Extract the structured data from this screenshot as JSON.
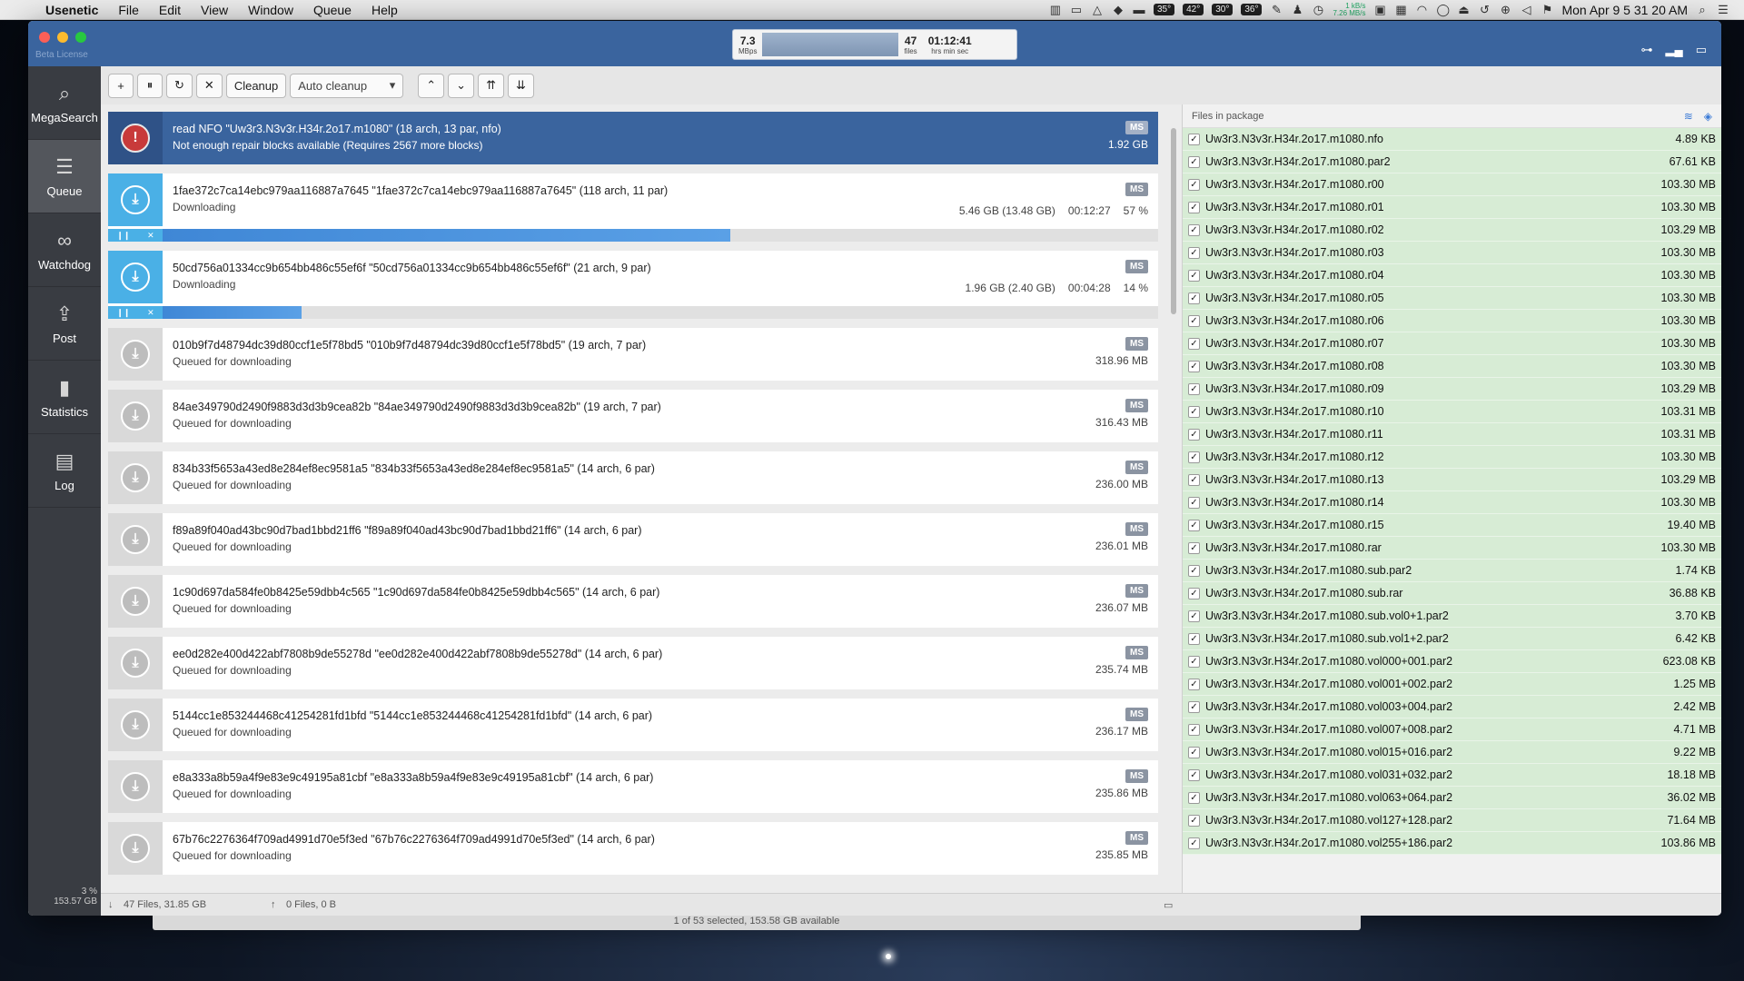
{
  "menubar": {
    "app": "Usenetic",
    "items": [
      "File",
      "Edit",
      "View",
      "Window",
      "Queue",
      "Help"
    ],
    "temps": [
      "35°",
      "42°",
      "30°",
      "36°"
    ],
    "net_up": "1 kB/s",
    "net_down": "7.26 MB/s",
    "clock": "Mon Apr 9  5 31 20 AM"
  },
  "window": {
    "license": "Beta License",
    "speed_value": "7.3",
    "speed_unit": "MBps",
    "files_value": "47",
    "files_unit": "files",
    "time_value": "01:12:41",
    "time_unit": "hrs min sec"
  },
  "sidebar": {
    "items": [
      {
        "label": "MegaSearch",
        "icon": "⌕"
      },
      {
        "label": "Queue",
        "icon": "☰"
      },
      {
        "label": "Watchdog",
        "icon": "∞"
      },
      {
        "label": "Post",
        "icon": "⇪"
      },
      {
        "label": "Statistics",
        "icon": "▮"
      },
      {
        "label": "Log",
        "icon": "▤"
      }
    ],
    "disk_percent": "3 %",
    "disk_free": "153.57 GB"
  },
  "toolbar": {
    "add": "+",
    "pause": "⏸",
    "retry": "↻",
    "remove": "✕",
    "cleanup": "Cleanup",
    "auto_cleanup": "Auto cleanup",
    "up": "⌃",
    "down": "⌄",
    "top": "⇈",
    "bottom": "⇊"
  },
  "queue": [
    {
      "title": "read NFO \"Uw3r3.N3v3r.H34r.2o17.m1080\" (18 arch, 13 par, nfo)",
      "status": "Not enough repair blocks available (Requires 2567 more blocks)",
      "badge": "MS",
      "size": "1.92 GB"
    },
    {
      "title": "1fae372c7ca14ebc979aa116887a7645 \"1fae372c7ca14ebc979aa116887a7645\" (118 arch, 11 par)",
      "status": "Downloading",
      "badge": "MS",
      "size": "5.46 GB (13.48 GB)",
      "eta": "00:12:27",
      "percent": "57 %",
      "progress": 0.57
    },
    {
      "title": "50cd756a01334cc9b654bb486c55ef6f \"50cd756a01334cc9b654bb486c55ef6f\" (21 arch, 9 par)",
      "status": "Downloading",
      "badge": "MS",
      "size": "1.96 GB (2.40 GB)",
      "eta": "00:04:28",
      "percent": "14 %",
      "progress": 0.14
    },
    {
      "title": "010b9f7d48794dc39d80ccf1e5f78bd5 \"010b9f7d48794dc39d80ccf1e5f78bd5\" (19 arch, 7 par)",
      "status": "Queued for downloading",
      "badge": "MS",
      "size": "318.96 MB"
    },
    {
      "title": "84ae349790d2490f9883d3d3b9cea82b \"84ae349790d2490f9883d3d3b9cea82b\" (19 arch, 7 par)",
      "status": "Queued for downloading",
      "badge": "MS",
      "size": "316.43 MB"
    },
    {
      "title": "834b33f5653a43ed8e284ef8ec9581a5 \"834b33f5653a43ed8e284ef8ec9581a5\" (14 arch, 6 par)",
      "status": "Queued for downloading",
      "badge": "MS",
      "size": "236.00 MB"
    },
    {
      "title": "f89a89f040ad43bc90d7bad1bbd21ff6 \"f89a89f040ad43bc90d7bad1bbd21ff6\" (14 arch, 6 par)",
      "status": "Queued for downloading",
      "badge": "MS",
      "size": "236.01 MB"
    },
    {
      "title": "1c90d697da584fe0b8425e59dbb4c565 \"1c90d697da584fe0b8425e59dbb4c565\" (14 arch, 6 par)",
      "status": "Queued for downloading",
      "badge": "MS",
      "size": "236.07 MB"
    },
    {
      "title": "ee0d282e400d422abf7808b9de55278d \"ee0d282e400d422abf7808b9de55278d\" (14 arch, 6 par)",
      "status": "Queued for downloading",
      "badge": "MS",
      "size": "235.74 MB"
    },
    {
      "title": "5144cc1e853244468c41254281fd1bfd \"5144cc1e853244468c41254281fd1bfd\" (14 arch, 6 par)",
      "status": "Queued for downloading",
      "badge": "MS",
      "size": "236.17 MB"
    },
    {
      "title": "e8a333a8b59a4f9e83e9c49195a81cbf \"e8a333a8b59a4f9e83e9c49195a81cbf\" (14 arch, 6 par)",
      "status": "Queued for downloading",
      "badge": "MS",
      "size": "235.86 MB"
    },
    {
      "title": "67b76c2276364f709ad4991d70e5f3ed \"67b76c2276364f709ad4991d70e5f3ed\" (14 arch, 6 par)",
      "status": "Queued for downloading",
      "badge": "MS",
      "size": "235.85 MB"
    }
  ],
  "statusbar": {
    "downloads": "47 Files, 31.85 GB",
    "uploads": "0 Files, 0 B"
  },
  "files_panel": {
    "header": "Files in package",
    "files": [
      {
        "name": "Uw3r3.N3v3r.H34r.2o17.m1080.nfo",
        "size": "4.89 KB"
      },
      {
        "name": "Uw3r3.N3v3r.H34r.2o17.m1080.par2",
        "size": "67.61 KB"
      },
      {
        "name": "Uw3r3.N3v3r.H34r.2o17.m1080.r00",
        "size": "103.30 MB"
      },
      {
        "name": "Uw3r3.N3v3r.H34r.2o17.m1080.r01",
        "size": "103.30 MB"
      },
      {
        "name": "Uw3r3.N3v3r.H34r.2o17.m1080.r02",
        "size": "103.29 MB"
      },
      {
        "name": "Uw3r3.N3v3r.H34r.2o17.m1080.r03",
        "size": "103.30 MB"
      },
      {
        "name": "Uw3r3.N3v3r.H34r.2o17.m1080.r04",
        "size": "103.30 MB"
      },
      {
        "name": "Uw3r3.N3v3r.H34r.2o17.m1080.r05",
        "size": "103.30 MB"
      },
      {
        "name": "Uw3r3.N3v3r.H34r.2o17.m1080.r06",
        "size": "103.30 MB"
      },
      {
        "name": "Uw3r3.N3v3r.H34r.2o17.m1080.r07",
        "size": "103.30 MB"
      },
      {
        "name": "Uw3r3.N3v3r.H34r.2o17.m1080.r08",
        "size": "103.30 MB"
      },
      {
        "name": "Uw3r3.N3v3r.H34r.2o17.m1080.r09",
        "size": "103.29 MB"
      },
      {
        "name": "Uw3r3.N3v3r.H34r.2o17.m1080.r10",
        "size": "103.31 MB"
      },
      {
        "name": "Uw3r3.N3v3r.H34r.2o17.m1080.r11",
        "size": "103.31 MB"
      },
      {
        "name": "Uw3r3.N3v3r.H34r.2o17.m1080.r12",
        "size": "103.30 MB"
      },
      {
        "name": "Uw3r3.N3v3r.H34r.2o17.m1080.r13",
        "size": "103.29 MB"
      },
      {
        "name": "Uw3r3.N3v3r.H34r.2o17.m1080.r14",
        "size": "103.30 MB"
      },
      {
        "name": "Uw3r3.N3v3r.H34r.2o17.m1080.r15",
        "size": "19.40 MB"
      },
      {
        "name": "Uw3r3.N3v3r.H34r.2o17.m1080.rar",
        "size": "103.30 MB"
      },
      {
        "name": "Uw3r3.N3v3r.H34r.2o17.m1080.sub.par2",
        "size": "1.74 KB"
      },
      {
        "name": "Uw3r3.N3v3r.H34r.2o17.m1080.sub.rar",
        "size": "36.88 KB"
      },
      {
        "name": "Uw3r3.N3v3r.H34r.2o17.m1080.sub.vol0+1.par2",
        "size": "3.70 KB"
      },
      {
        "name": "Uw3r3.N3v3r.H34r.2o17.m1080.sub.vol1+2.par2",
        "size": "6.42 KB"
      },
      {
        "name": "Uw3r3.N3v3r.H34r.2o17.m1080.vol000+001.par2",
        "size": "623.08 KB"
      },
      {
        "name": "Uw3r3.N3v3r.H34r.2o17.m1080.vol001+002.par2",
        "size": "1.25 MB"
      },
      {
        "name": "Uw3r3.N3v3r.H34r.2o17.m1080.vol003+004.par2",
        "size": "2.42 MB"
      },
      {
        "name": "Uw3r3.N3v3r.H34r.2o17.m1080.vol007+008.par2",
        "size": "4.71 MB"
      },
      {
        "name": "Uw3r3.N3v3r.H34r.2o17.m1080.vol015+016.par2",
        "size": "9.22 MB"
      },
      {
        "name": "Uw3r3.N3v3r.H34r.2o17.m1080.vol031+032.par2",
        "size": "18.18 MB"
      },
      {
        "name": "Uw3r3.N3v3r.H34r.2o17.m1080.vol063+064.par2",
        "size": "36.02 MB"
      },
      {
        "name": "Uw3r3.N3v3r.H34r.2o17.m1080.vol127+128.par2",
        "size": "71.64 MB"
      },
      {
        "name": "Uw3r3.N3v3r.H34r.2o17.m1080.vol255+186.par2",
        "size": "103.86 MB"
      }
    ]
  },
  "under_window": "1 of 53 selected, 153.58 GB available",
  "colors": {
    "accent": "#3a649e",
    "sidebar": "#393c42",
    "download": "#4ab0e6",
    "file_row": "#d7ecd5",
    "error": "#c83a3a"
  }
}
